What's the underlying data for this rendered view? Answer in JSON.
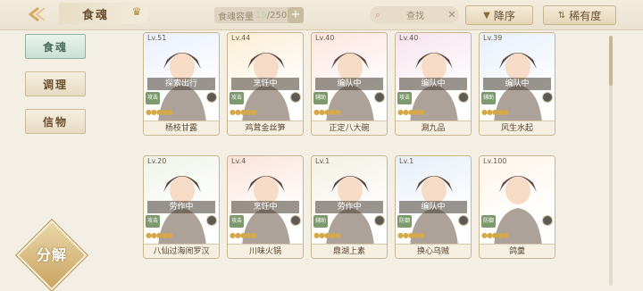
{
  "topbar": {
    "title": "食魂",
    "capacity_label": "食魂容量",
    "capacity_current": "19",
    "capacity_max": "/250",
    "search_placeholder": "查找",
    "sort_order_label": "降序",
    "sort_rarity_label": "稀有度"
  },
  "sidebar": {
    "tabs": [
      {
        "label": "食魂",
        "active": true
      },
      {
        "label": "调理",
        "active": false
      },
      {
        "label": "信物",
        "active": false
      }
    ],
    "decompose_label": "分解"
  },
  "cards": [
    {
      "level": "Lv.51",
      "status": "探索出行",
      "role": "攻击",
      "name": "杨枝甘露",
      "art": "#eaf0ff"
    },
    {
      "level": "Lv.44",
      "status": "烹饪中",
      "role": "攻击",
      "name": "鸡茸金丝笋",
      "art": "#fbeed4"
    },
    {
      "level": "Lv.40",
      "status": "编队中",
      "role": "辅助",
      "name": "正定八大碗",
      "art": "#fde4e0"
    },
    {
      "level": "Lv.40",
      "status": "编队中",
      "role": "攻击",
      "name": "涮九品",
      "art": "#f6e3ef"
    },
    {
      "level": "Lv.39",
      "status": "编队中",
      "role": "辅助",
      "name": "风生水起",
      "art": "#e6f0fb"
    },
    {
      "level": "Lv.20",
      "status": "劳作中",
      "role": "攻击",
      "name": "八仙过海闹罗汉",
      "art": "#eef4ea"
    },
    {
      "level": "Lv.4",
      "status": "烹饪中",
      "role": "攻击",
      "name": "川味火锅",
      "art": "#fbe3da"
    },
    {
      "level": "Lv.1",
      "status": "劳作中",
      "role": "辅助",
      "name": "鼎湖上素",
      "art": "#f3efe3"
    },
    {
      "level": "Lv.1",
      "status": "编队中",
      "role": "防御",
      "name": "换心乌贼",
      "art": "#e5eef7"
    },
    {
      "level": "Lv.100",
      "status": "",
      "role": "防御",
      "name": "鸽羹",
      "art": "#fff4ea"
    }
  ]
}
